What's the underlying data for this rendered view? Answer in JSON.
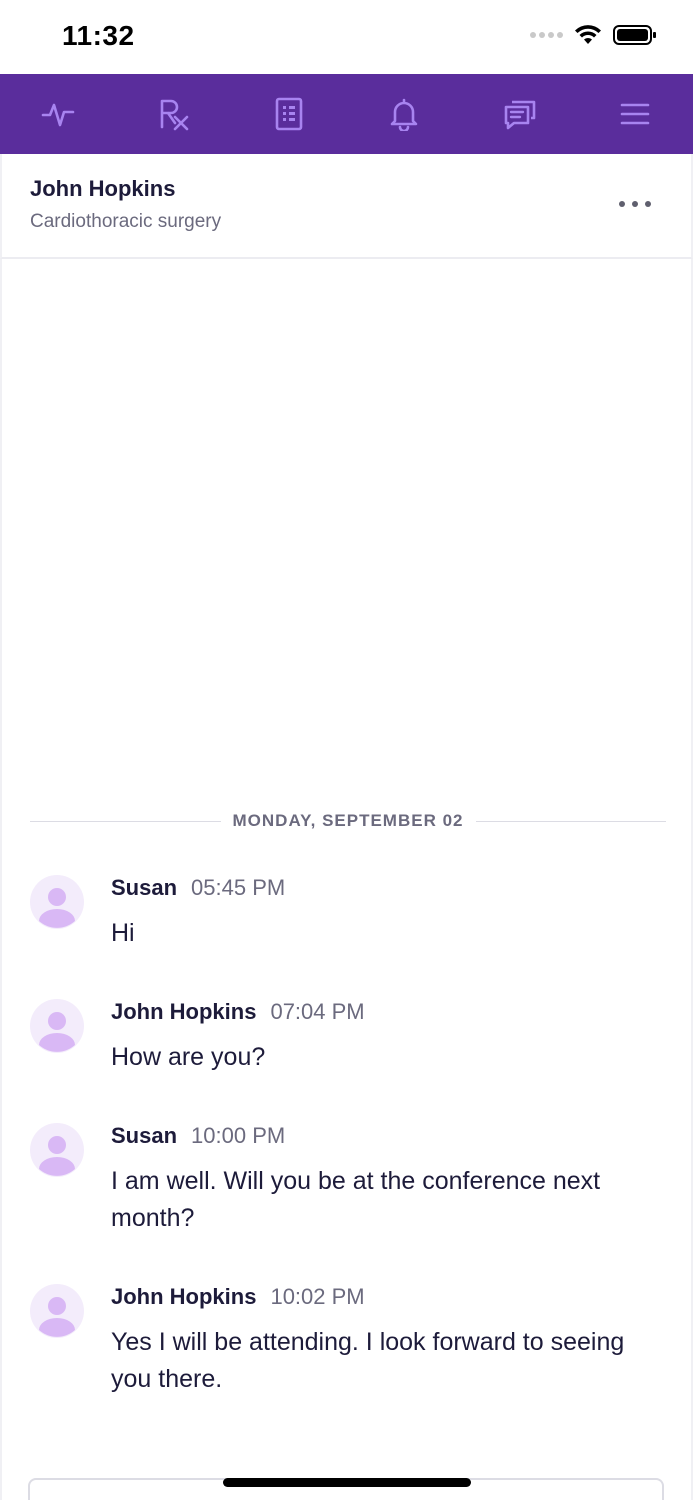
{
  "status_bar": {
    "time": "11:32"
  },
  "nav": {
    "accent": "#5a2d9c",
    "icon_color": "#a884f0",
    "icons": [
      "vitals-icon",
      "prescription-icon",
      "document-icon",
      "bell-icon",
      "chat-icon",
      "menu-icon"
    ]
  },
  "header": {
    "name": "John Hopkins",
    "subtitle": "Cardiothoracic surgery"
  },
  "chat": {
    "date_label": "MONDAY, SEPTEMBER 02",
    "messages": [
      {
        "sender": "Susan",
        "time": "05:45 PM",
        "text": "Hi"
      },
      {
        "sender": "John Hopkins",
        "time": "07:04 PM",
        "text": "How are you?"
      },
      {
        "sender": "Susan",
        "time": "10:00 PM",
        "text": "I am well. Will you be at the conference next month?"
      },
      {
        "sender": "John Hopkins",
        "time": "10:02 PM",
        "text": "Yes I will be attending. I look forward to seeing you there."
      }
    ]
  }
}
